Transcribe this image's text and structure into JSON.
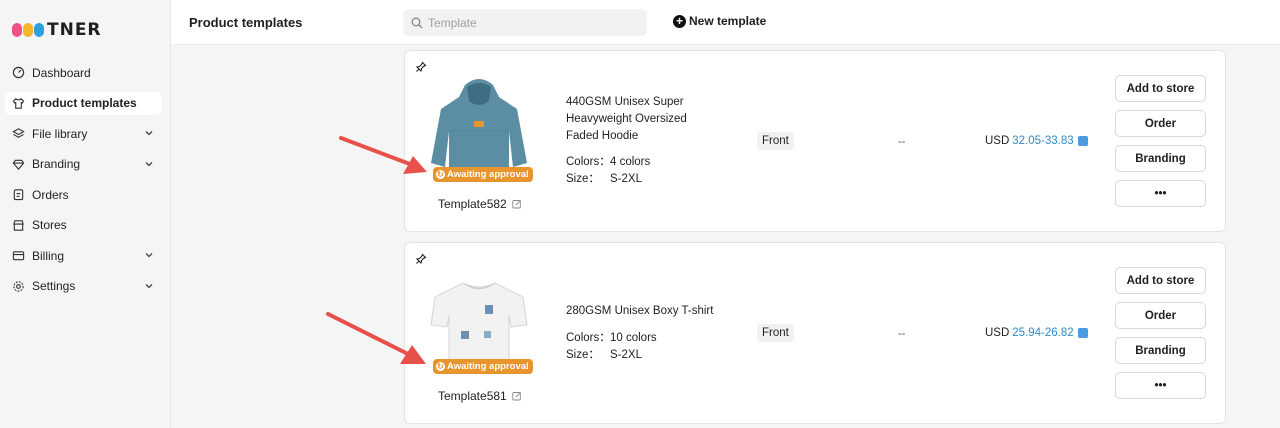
{
  "brand": {
    "name": "TNER",
    "mark_colors": [
      "#f0508c",
      "#f5b62a",
      "#2e9fe0"
    ]
  },
  "sidebar": {
    "items": [
      {
        "label": "Dashboard",
        "icon": "dashboard-icon",
        "active": false,
        "expandable": false
      },
      {
        "label": "Product templates",
        "icon": "tshirt-icon",
        "active": true,
        "expandable": false
      },
      {
        "label": "File library",
        "icon": "layers-icon",
        "active": false,
        "expandable": true
      },
      {
        "label": "Branding",
        "icon": "diamond-icon",
        "active": false,
        "expandable": true
      },
      {
        "label": "Orders",
        "icon": "clipboard-icon",
        "active": false,
        "expandable": false
      },
      {
        "label": "Stores",
        "icon": "store-icon",
        "active": false,
        "expandable": false
      },
      {
        "label": "Billing",
        "icon": "wallet-icon",
        "active": false,
        "expandable": true
      },
      {
        "label": "Settings",
        "icon": "gear-icon",
        "active": false,
        "expandable": true
      }
    ]
  },
  "header": {
    "title": "Product templates",
    "search_placeholder": "Template",
    "search_value": "",
    "new_template_label": "New template"
  },
  "templates": [
    {
      "product_title": "440GSM Unisex Super Heavyweight Oversized Faded Hoodie",
      "colors_label": "Colors：",
      "colors_value": "4 colors",
      "size_label": "Size：",
      "size_value": "S-2XL",
      "placement": "Front",
      "dash": "--",
      "currency": "USD",
      "price": "32.05-33.83",
      "status": "Awaiting approval",
      "template_name": "Template582",
      "thumbnail": "hoodie-image",
      "garment_color": "#5b8da3",
      "buttons": {
        "add": "Add to store",
        "order": "Order",
        "branding": "Branding",
        "more": "•••"
      }
    },
    {
      "product_title": "280GSM Unisex Boxy T-shirt",
      "colors_label": "Colors：",
      "colors_value": "10 colors",
      "size_label": "Size：",
      "size_value": "S-2XL",
      "placement": "Front",
      "dash": "--",
      "currency": "USD",
      "price": "25.94-26.82",
      "status": "Awaiting approval",
      "template_name": "Template581",
      "thumbnail": "tshirt-image",
      "garment_color": "#f2f2f2",
      "buttons": {
        "add": "Add to store",
        "order": "Order",
        "branding": "Branding",
        "more": "•••"
      }
    }
  ],
  "colors": {
    "accent_link": "#2d8bc7",
    "badge": "#e8952e",
    "annotation_arrow": "#e8514a"
  }
}
